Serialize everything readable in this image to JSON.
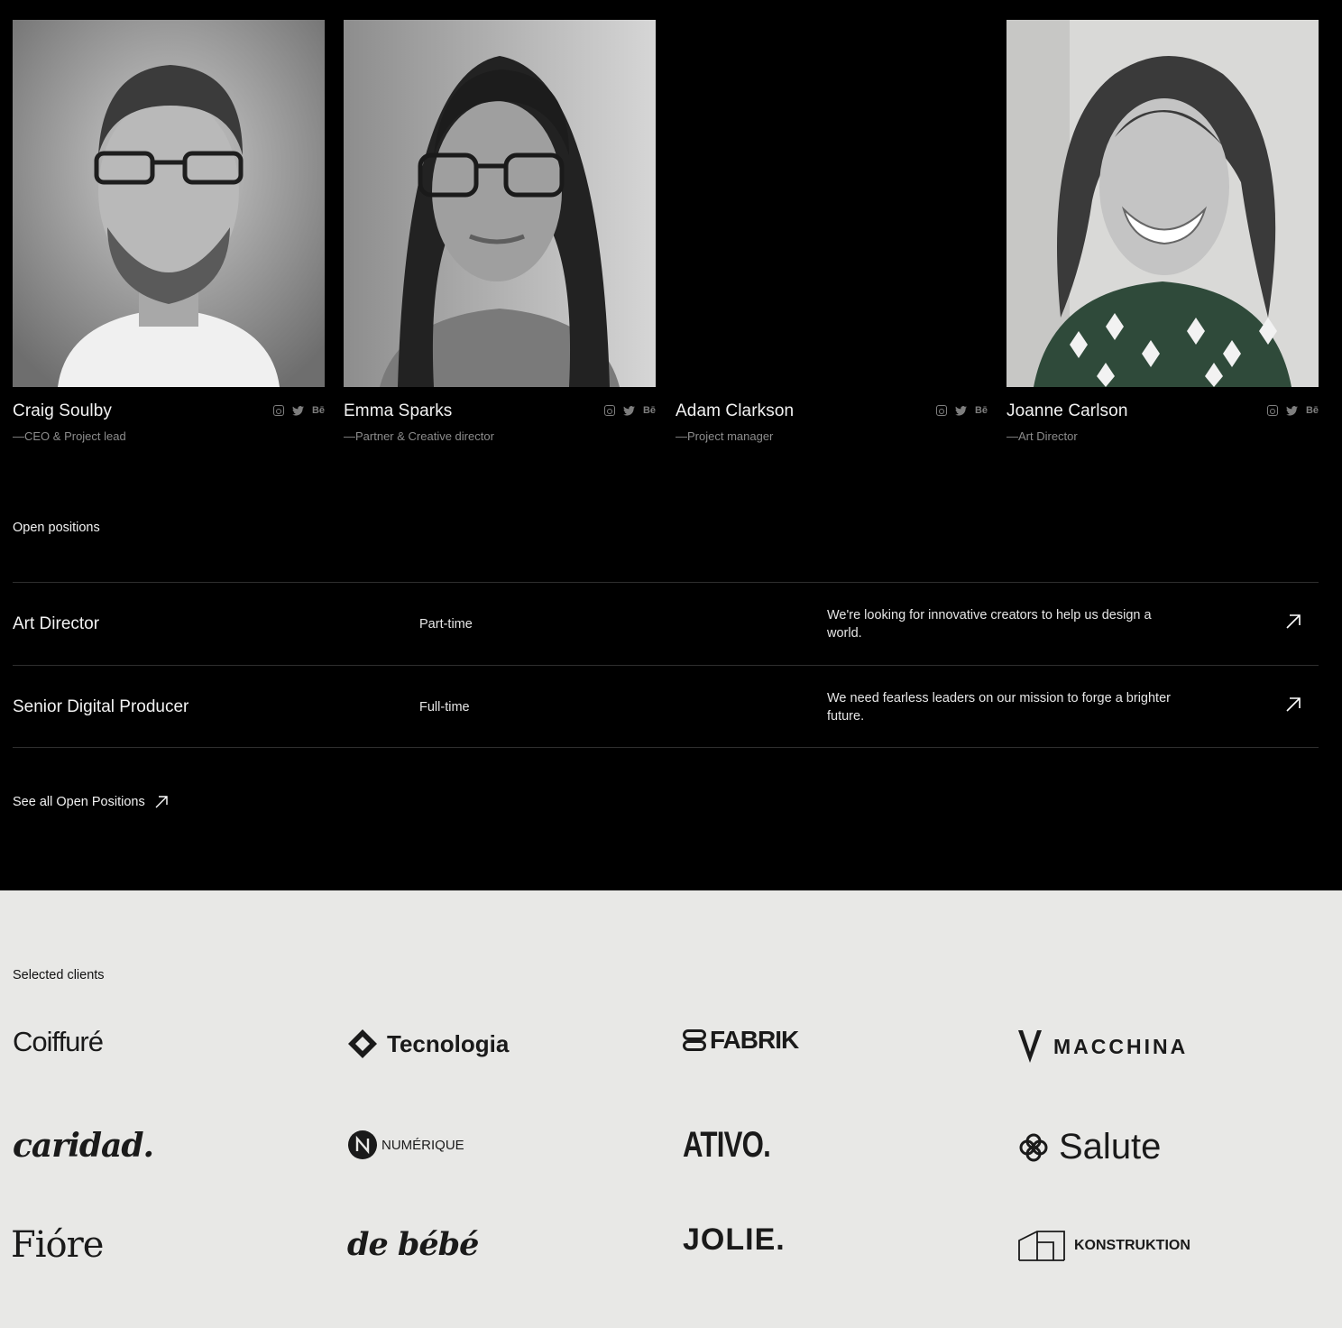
{
  "team": {
    "members": [
      {
        "name": "Craig Soulby",
        "role": "—CEO & Project lead",
        "social": [
          "instagram-icon",
          "twitter-icon",
          "Bē"
        ]
      },
      {
        "name": "Emma Sparks",
        "role": "—Partner & Creative director",
        "social": [
          "instagram-icon",
          "twitter-icon",
          "Bē"
        ]
      },
      {
        "name": "Adam Clarkson",
        "role": "—Project manager",
        "social": [
          "instagram-icon",
          "twitter-icon",
          "Bē"
        ]
      },
      {
        "name": "Joanne Carlson",
        "role": "—Art Director",
        "social": [
          "instagram-icon",
          "twitter-icon",
          "Bē"
        ]
      }
    ]
  },
  "positions": {
    "label": "Open positions",
    "rows": [
      {
        "title": "Art Director",
        "type": "Part-time",
        "description": "We're looking for innovative creators to help us design a world."
      },
      {
        "title": "Senior Digital Producer",
        "type": "Full-time",
        "description": "We need fearless leaders on our mission to forge a brighter future."
      }
    ],
    "see_all": "See all Open Positions"
  },
  "clients": {
    "label": "Selected clients",
    "logos": [
      "Coiffuré",
      "Tecnologia",
      "FABRIK",
      "MACCHINA",
      "caridad.",
      "NUMÉRIQUE",
      "ATIVO.",
      "Salute",
      "Fióre",
      "de bébé",
      "JOLIE.",
      "KONSTRUKTION"
    ]
  },
  "colors": {
    "dark_bg": "#000000",
    "light_bg": "#e8e8e6",
    "muted_text": "#8c8c8c",
    "divider": "#2e2e2e"
  }
}
